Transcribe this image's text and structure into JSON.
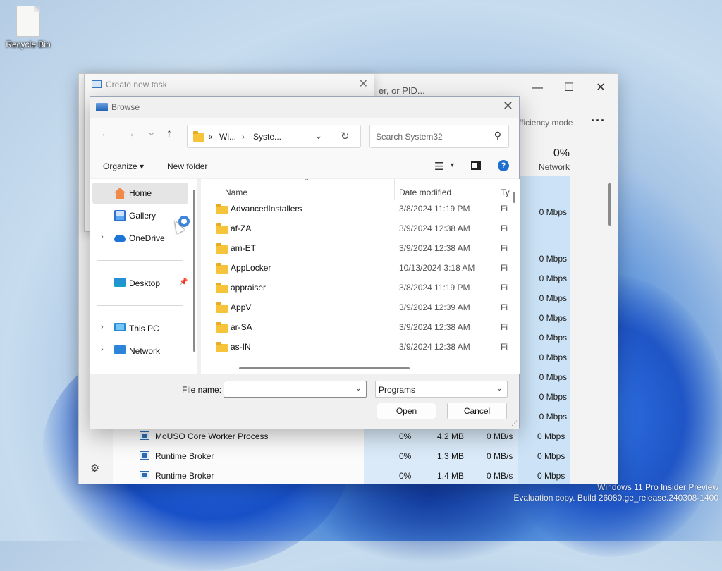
{
  "desktop": {
    "recycle_bin": "Recycle Bin",
    "watermark_line1": "Windows 11 Pro Insider Preview",
    "watermark_line2": "Evaluation copy. Build 26080.ge_release.240308-1400"
  },
  "task_manager": {
    "search_text": "er, or PID...",
    "minimize": "—",
    "maximize": "☐",
    "close": "✕",
    "efficiency_mode": "fficiency mode",
    "more": "···",
    "network_pct": "0%",
    "network_label": "Network",
    "network_values": [
      "0 Mbps",
      "0 Mbps",
      "0 Mbps",
      "0 Mbps",
      "0 Mbps",
      "0 Mbps",
      "0 Mbps",
      "0 Mbps",
      "0 Mbps",
      "0 Mbps",
      "0 Mbps",
      "0 Mbps",
      "0 Mbps"
    ],
    "rows": [
      {
        "name": "MoUSO Core Worker Process",
        "cpu": "0%",
        "memory": "4.2 MB",
        "disk": "0 MB/s",
        "network": "0 Mbps"
      },
      {
        "name": "Runtime Broker",
        "cpu": "0%",
        "memory": "1.3 MB",
        "disk": "0 MB/s",
        "network": "0 Mbps"
      },
      {
        "name": "Runtime Broker",
        "cpu": "0%",
        "memory": "1.4 MB",
        "disk": "0 MB/s",
        "network": "0 Mbps"
      }
    ],
    "settings_icon": "⚙"
  },
  "create_task": {
    "title": "Create new task",
    "close": "✕"
  },
  "browse": {
    "title": "Browse",
    "close": "✕",
    "nav": {
      "back": "←",
      "forward": "→",
      "recent": "⌄",
      "up": "↑"
    },
    "address": {
      "prefix": "«",
      "crumb1": "Wi...",
      "sep": "›",
      "crumb2": "Syste...",
      "dropdown": "⌄",
      "refresh": "↻"
    },
    "search_placeholder": "Search System32",
    "search_icon": "⚲",
    "toolbar": {
      "organize": "Organize ▾",
      "new_folder": "New folder",
      "view": "☰",
      "view_dd": "▾",
      "help": "?"
    },
    "sidebar": [
      {
        "label": "Home",
        "icon": "home-icon",
        "selected": true
      },
      {
        "label": "Gallery",
        "icon": "gallery-icon"
      },
      {
        "label": "OneDrive",
        "icon": "cloud-icon",
        "expandable": true
      },
      {
        "label": "Desktop",
        "icon": "desktop-icon",
        "pinned": true
      },
      {
        "label": "This PC",
        "icon": "computer-icon",
        "expandable": true
      },
      {
        "label": "Network",
        "icon": "network-icon",
        "expandable": true
      }
    ],
    "chevron": "›",
    "pin": "📌",
    "columns": {
      "name": "Name",
      "date": "Date modified",
      "type": "Ty"
    },
    "sort_caret": "⌃",
    "files": [
      {
        "name": "AdvancedInstallers",
        "date": "3/8/2024 11:19 PM",
        "type": "Fi"
      },
      {
        "name": "af-ZA",
        "date": "3/9/2024 12:38 AM",
        "type": "Fi"
      },
      {
        "name": "am-ET",
        "date": "3/9/2024 12:38 AM",
        "type": "Fi"
      },
      {
        "name": "AppLocker",
        "date": "10/13/2024 3:18 AM",
        "type": "Fi"
      },
      {
        "name": "appraiser",
        "date": "3/8/2024 11:19 PM",
        "type": "Fi"
      },
      {
        "name": "AppV",
        "date": "3/9/2024 12:39 AM",
        "type": "Fi"
      },
      {
        "name": "ar-SA",
        "date": "3/9/2024 12:38 AM",
        "type": "Fi"
      },
      {
        "name": "as-IN",
        "date": "3/9/2024 12:38 AM",
        "type": "Fi"
      }
    ],
    "file_name_label": "File name:",
    "file_name_value": "",
    "file_type": "Programs",
    "dropdown": "⌄",
    "open": "Open",
    "cancel": "Cancel",
    "grip": "⋰"
  }
}
